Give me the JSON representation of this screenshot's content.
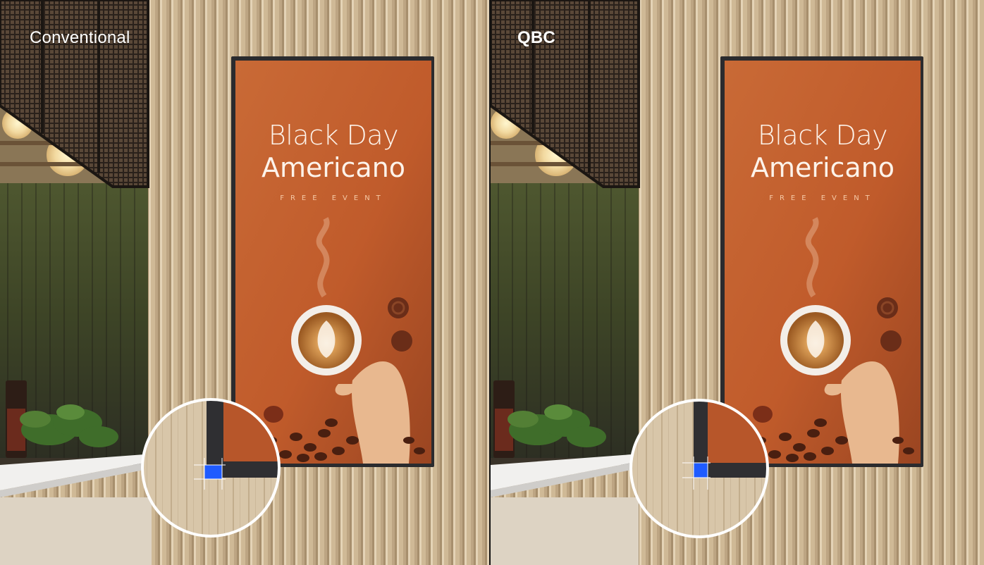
{
  "labels": {
    "left": "Conventional",
    "right": "QBC"
  },
  "display": {
    "line1": "Black Day",
    "line2": "Americano",
    "subtitle": "FREE EVENT"
  },
  "colors": {
    "wall": "#cdb796",
    "slat_dark": "#a9916f",
    "display_orange": "#c25f2e",
    "bezel": "#2b2b2e",
    "highlight_blue": "#1f5bff",
    "counter": "#f1f0ee"
  },
  "icons": {
    "coffee": "coffee-cup-icon",
    "bean": "coffee-bean-icon",
    "chocolate": "chocolate-icon"
  }
}
